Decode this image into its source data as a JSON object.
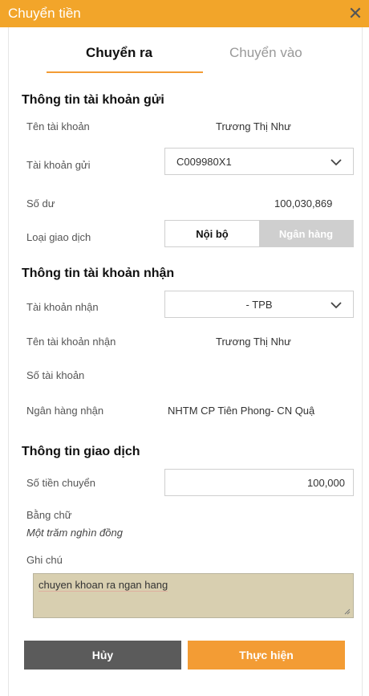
{
  "window": {
    "title": "Chuyển tiền"
  },
  "tabs": [
    {
      "label": "Chuyển ra"
    },
    {
      "label": "Chuyển vào"
    }
  ],
  "sender": {
    "section_title": "Thông tin tài khoản gửi",
    "account_name_label": "Tên tài khoản",
    "account_name_value": "Trương Thị Như",
    "account_label": "Tài khoản gửi",
    "account_value": "C009980X1",
    "balance_label": "Số dư",
    "balance_value": "100,030,869",
    "txn_type_label": "Loại giao dịch",
    "txn_type_internal": "Nội bộ",
    "txn_type_bank": "Ngân hàng"
  },
  "receiver": {
    "section_title": "Thông tin tài khoản nhận",
    "account_label": "Tài khoản nhận",
    "account_value": "- TPB",
    "name_label": "Tên tài khoản nhận",
    "name_value": "Trương Thị Như",
    "number_label": "Số tài khoản",
    "bank_label": "Ngân hàng nhận",
    "bank_value": "NHTM CP Tiên Phong- CN Quậ"
  },
  "transaction": {
    "section_title": "Thông tin giao dịch",
    "amount_label": "Số tiền chuyển",
    "amount_value": "100,000",
    "words_label": "Bằng chữ",
    "words_value": "Một trăm nghìn đồng",
    "note_label": "Ghi chú",
    "note_value": "chuyen khoan ra ngan hang"
  },
  "actions": {
    "cancel_label": "Hủy",
    "submit_label": "Thực hiện"
  },
  "colors": {
    "accent": "#f39c34",
    "titlebar": "#f2a52a",
    "cancel": "#5b5b5b"
  }
}
